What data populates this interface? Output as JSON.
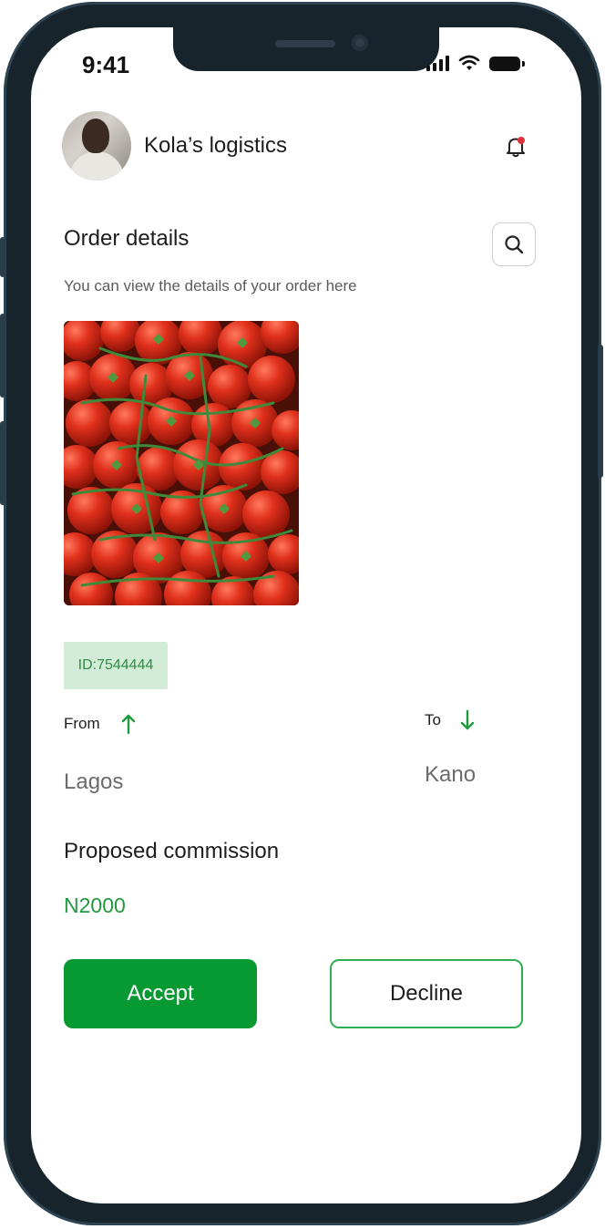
{
  "status_bar": {
    "time": "9:41"
  },
  "header": {
    "company_name": "Kola’s logistics",
    "avatar_icon": "user-avatar",
    "notification_icon": "bell-icon",
    "notification_dot_color": "#e0303a"
  },
  "order": {
    "title": "Order details",
    "subtitle": "You can view the details of your order here",
    "search_icon": "search-icon",
    "image_subject": "tomatoes",
    "id_text": "ID:7544444",
    "from_label": "From",
    "from_value": "Lagos",
    "to_label": "To",
    "to_value": "Kano",
    "commission_label": "Proposed commission",
    "commission_value": "N2000"
  },
  "actions": {
    "accept_label": "Accept",
    "decline_label": "Decline"
  },
  "colors": {
    "accent_green": "#079a32",
    "id_badge_bg": "#d2ecd8",
    "phone_frame": "#17242c"
  }
}
